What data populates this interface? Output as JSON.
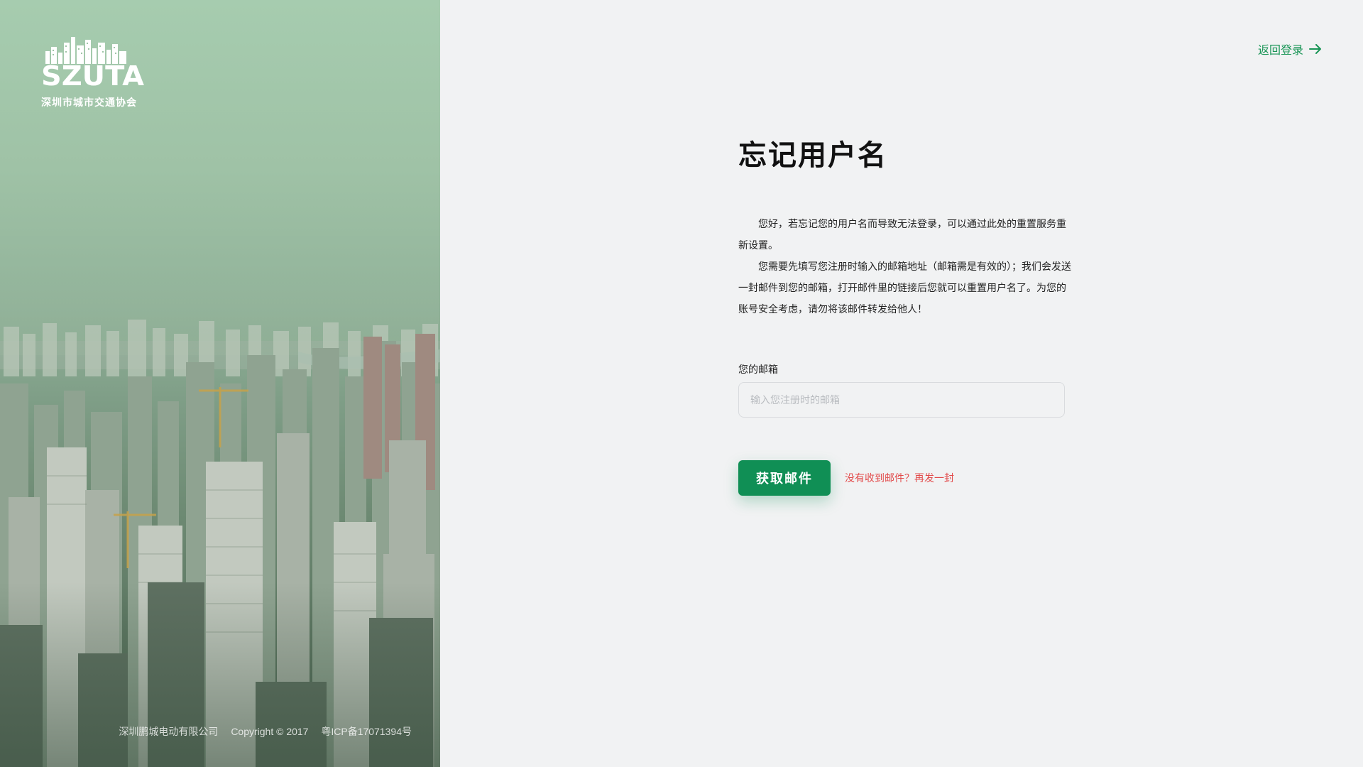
{
  "brand": {
    "logo_mark": "SZUTA",
    "logo_subtitle": "深圳市城市交通协会"
  },
  "footer": {
    "company": "深圳鹏城电动有限公司",
    "copyright": "Copyright © 2017",
    "icp": "粤ICP备17071394号"
  },
  "nav": {
    "back_label": "返回登录"
  },
  "main": {
    "title": "忘记用户名",
    "paragraph1": "您好，若忘记您的用户名而导致无法登录，可以通过此处的重置服务重新设置。",
    "paragraph2": "您需要先填写您注册时输入的邮箱地址（邮箱需是有效的）；我们会发送一封邮件到您的邮箱，打开邮件里的链接后您就可以重置用户名了。为您的账号安全考虑，请勿将该邮件转发给他人！"
  },
  "form": {
    "email_label": "您的邮箱",
    "email_placeholder": "输入您注册时的邮箱",
    "email_value": "",
    "submit_label": "获取邮件",
    "resend_label": "没有收到邮件？再发一封"
  },
  "colors": {
    "accent": "#108f55",
    "link": "#1a9556",
    "warning": "#e24a4a"
  },
  "icons": {
    "back": "arrow-right-icon"
  }
}
